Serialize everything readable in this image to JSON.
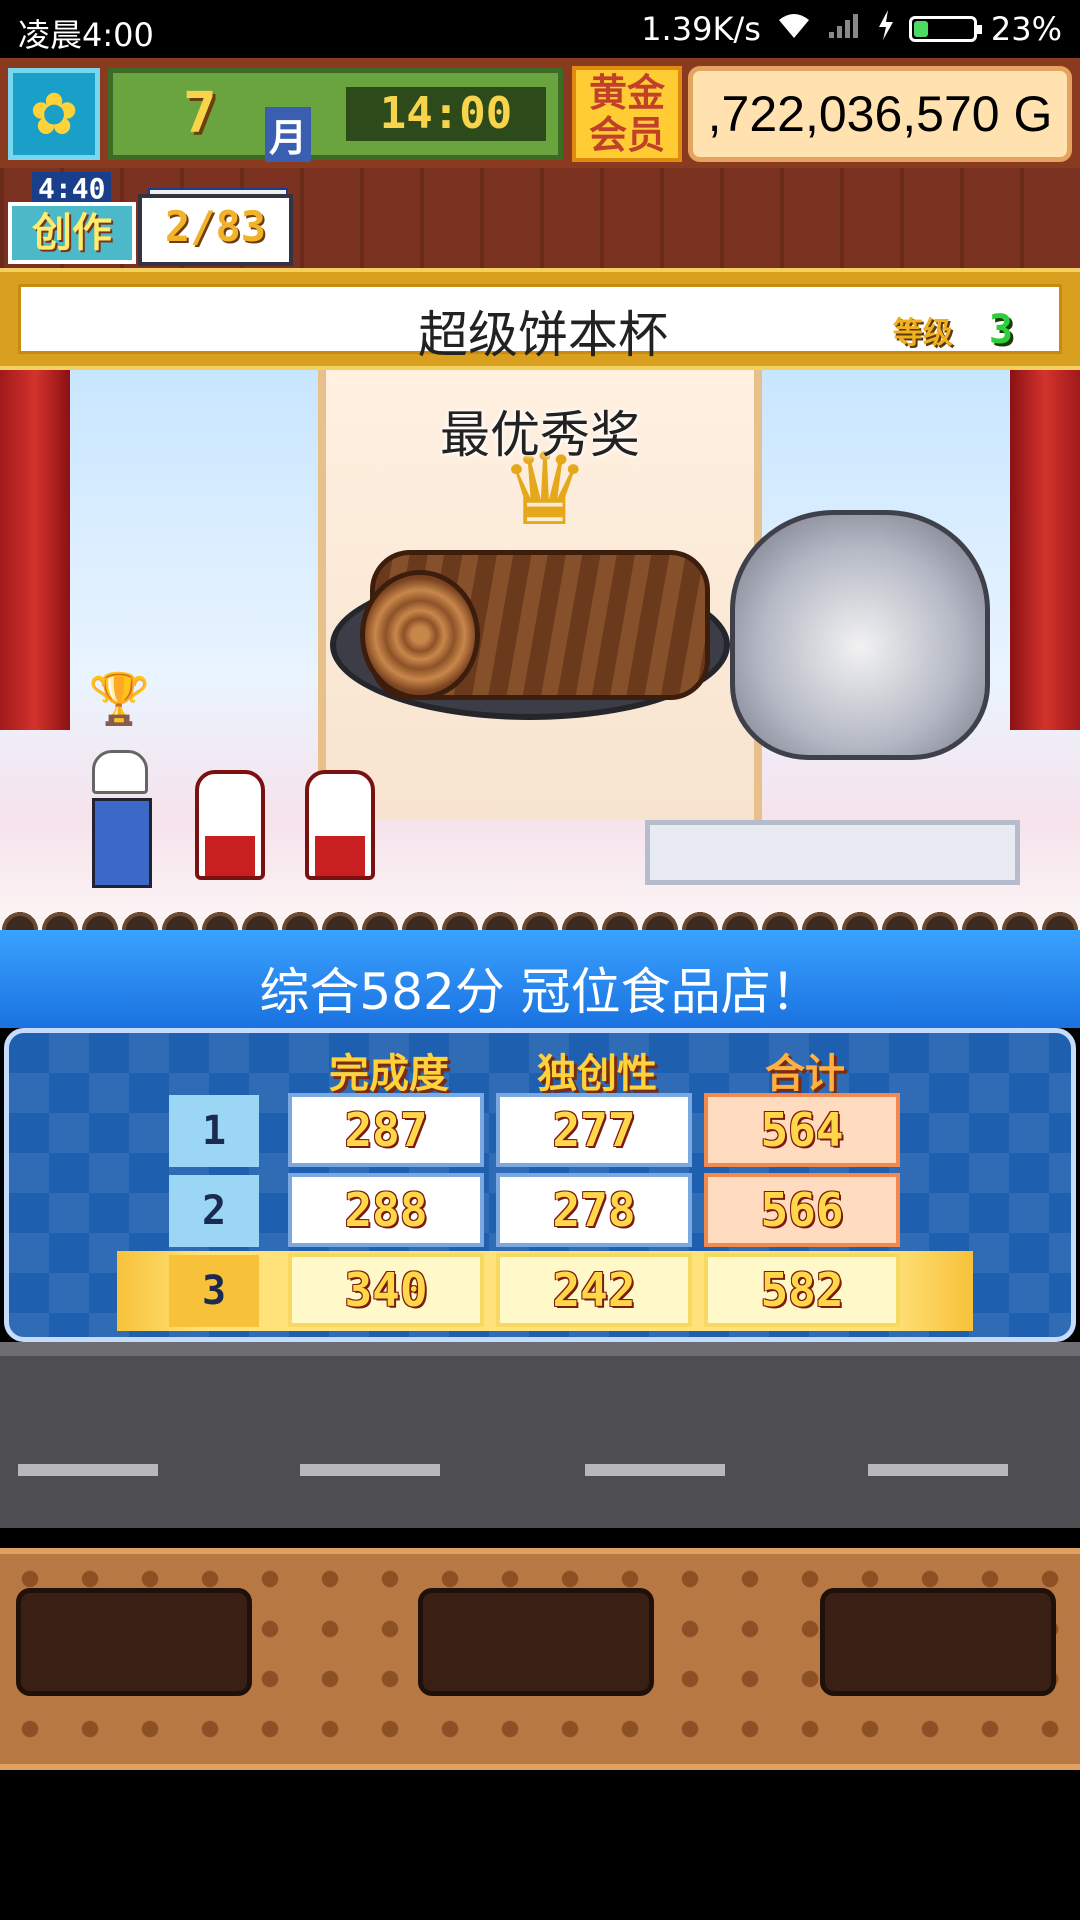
{
  "status_bar": {
    "time": "凌晨4:00",
    "network_speed": "1.39K/s",
    "battery_percent": "23%",
    "battery_level": 0.23,
    "icons": [
      "wifi-icon",
      "signal-icon",
      "charging-icon",
      "battery-icon"
    ]
  },
  "hud": {
    "icon": "sunflower-icon",
    "month_number": "7",
    "month_label": "月",
    "clock": "14:00",
    "gold_member_label": "黄金会员",
    "money": ",722,036,570 G"
  },
  "creation": {
    "timer": "4:40",
    "label": "创作",
    "count": "2/83"
  },
  "contest": {
    "title": "超级饼本杯",
    "level_label": "等级",
    "level_value": "3",
    "award": "最优秀奖"
  },
  "result": {
    "summary": "综合582分 冠位食品店！"
  },
  "scoreboard": {
    "headers": [
      "完成度",
      "独创性",
      "合计"
    ],
    "rows": [
      {
        "rank": "1",
        "completion": "287",
        "originality": "277",
        "total": "564"
      },
      {
        "rank": "2",
        "completion": "288",
        "originality": "278",
        "total": "566"
      },
      {
        "rank": "3",
        "completion": "340",
        "originality": "242",
        "total": "582"
      }
    ],
    "colors": {
      "header": "#ffd23a",
      "board": "#1e5fb0",
      "winner_row": "#f7c23a"
    }
  }
}
